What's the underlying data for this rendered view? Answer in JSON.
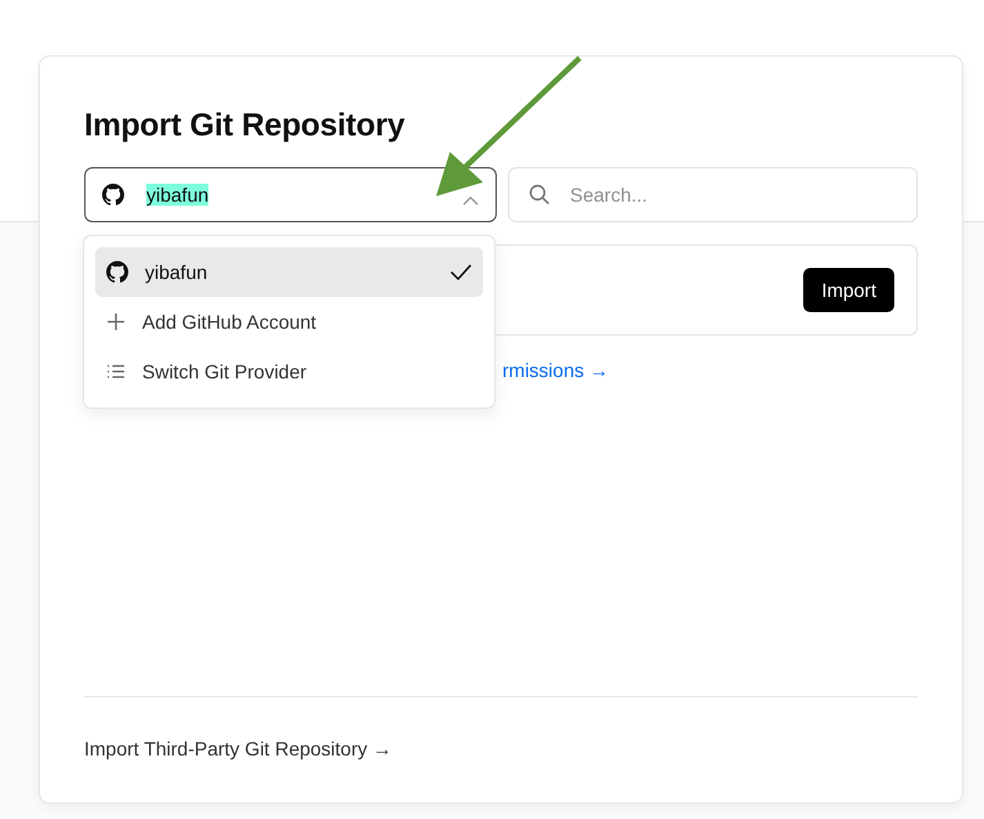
{
  "title": "Import Git Repository",
  "account_select": {
    "value": "yibafun",
    "expanded": true
  },
  "search": {
    "placeholder": "Search..."
  },
  "repository_row": {
    "button": "Import"
  },
  "permissions_link": "rmissions →",
  "dropdown": {
    "items": [
      {
        "kind": "account",
        "label": "yibafun",
        "selected": true
      },
      {
        "kind": "add",
        "label": "Add GitHub Account",
        "selected": false
      },
      {
        "kind": "switch",
        "label": "Switch Git Provider",
        "selected": false
      }
    ]
  },
  "footer_link": "Import Third-Party Git Repository →"
}
